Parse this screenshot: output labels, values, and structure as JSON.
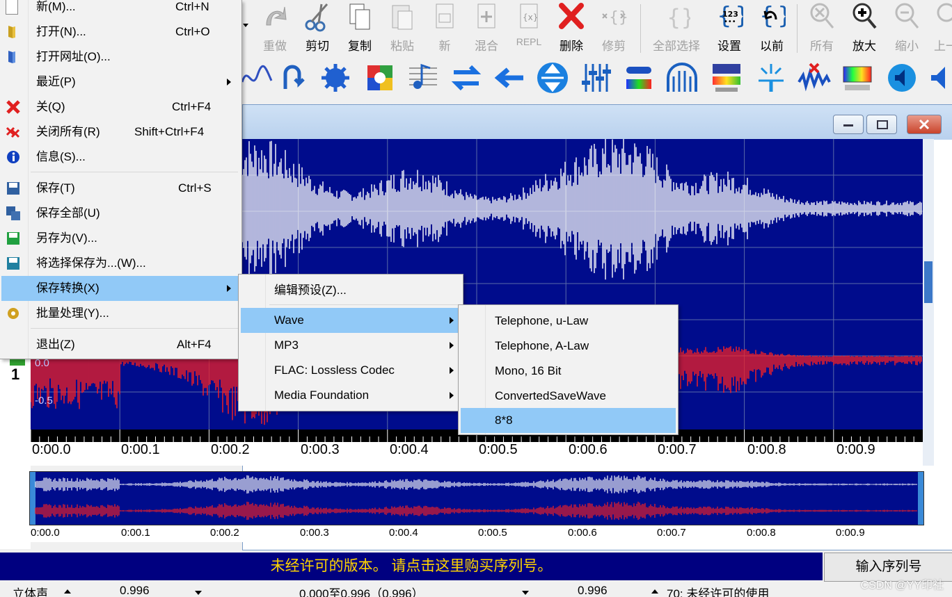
{
  "toolbar": {
    "buttons": [
      {
        "label": "重做",
        "icon": "redo-icon",
        "enabled": false
      },
      {
        "label": "剪切",
        "icon": "cut-icon",
        "enabled": true
      },
      {
        "label": "复制",
        "icon": "copy-icon",
        "enabled": true
      },
      {
        "label": "粘贴",
        "icon": "paste-icon",
        "enabled": false
      },
      {
        "label": "新",
        "icon": "new-icon",
        "enabled": false
      },
      {
        "label": "混合",
        "icon": "mix-icon",
        "enabled": false
      },
      {
        "label": "REPL",
        "icon": "replace-icon",
        "enabled": false
      },
      {
        "label": "删除",
        "icon": "delete-icon",
        "enabled": true
      },
      {
        "label": "修剪",
        "icon": "trim-icon",
        "enabled": false
      },
      {
        "label": "全部选择",
        "icon": "select-all-icon",
        "enabled": false
      },
      {
        "label": "设置",
        "icon": "settings-icon",
        "enabled": true
      },
      {
        "label": "以前",
        "icon": "previous-icon",
        "enabled": true
      },
      {
        "label": "所有",
        "icon": "zoom-all-icon",
        "enabled": false
      },
      {
        "label": "放大",
        "icon": "zoom-in-icon",
        "enabled": true
      },
      {
        "label": "缩小",
        "icon": "zoom-out-icon",
        "enabled": false
      },
      {
        "label": "上一",
        "icon": "zoom-prev-icon",
        "enabled": false
      }
    ],
    "settings_digits": "123"
  },
  "file_menu": {
    "items": [
      {
        "label": "新(M)...",
        "shortcut": "Ctrl+N",
        "icon": "new-file-icon"
      },
      {
        "label": "打开(N)...",
        "shortcut": "Ctrl+O",
        "icon": "open-icon"
      },
      {
        "label": "打开网址(O)...",
        "shortcut": "",
        "icon": "open-url-icon"
      },
      {
        "label": "最近(P)",
        "shortcut": "",
        "icon": "",
        "submenu": true
      },
      {
        "label": "关(Q)",
        "shortcut": "Ctrl+F4",
        "icon": "close-icon"
      },
      {
        "label": "关闭所有(R)",
        "shortcut": "Shift+Ctrl+F4",
        "icon": "close-all-icon"
      },
      {
        "label": "信息(S)...",
        "shortcut": "",
        "icon": "info-icon"
      },
      {
        "label": "保存(T)",
        "shortcut": "Ctrl+S",
        "icon": "save-icon"
      },
      {
        "label": "保存全部(U)",
        "shortcut": "",
        "icon": "save-all-icon"
      },
      {
        "label": "另存为(V)...",
        "shortcut": "",
        "icon": "save-as-icon"
      },
      {
        "label": "将选择保存为...(W)...",
        "shortcut": "",
        "icon": "save-selection-icon"
      },
      {
        "label": "保存转换(X)",
        "shortcut": "",
        "icon": "",
        "submenu": true,
        "highlighted": true
      },
      {
        "label": "批量处理(Y)...",
        "shortcut": "",
        "icon": "batch-icon"
      },
      {
        "label": "退出(Z)",
        "shortcut": "Alt+F4",
        "icon": ""
      }
    ]
  },
  "convert_menu": {
    "items": [
      {
        "label": "编辑预设(Z)...",
        "submenu": false
      },
      {
        "label": "Wave",
        "submenu": true,
        "highlighted": true
      },
      {
        "label": "MP3",
        "submenu": true
      },
      {
        "label": "FLAC: Lossless Codec",
        "submenu": true
      },
      {
        "label": "Media Foundation",
        "submenu": true
      }
    ]
  },
  "wave_menu": {
    "items": [
      {
        "label": "Telephone, u-Law"
      },
      {
        "label": "Telephone, A-Law"
      },
      {
        "label": "Mono, 16 Bit"
      },
      {
        "label": "ConvertedSaveWave"
      },
      {
        "label": "8*8",
        "highlighted": true
      }
    ]
  },
  "waveform": {
    "amplitude_labels": [
      "0.0",
      "-0.5"
    ],
    "channel_number": "1",
    "timeline": [
      "0:00.0",
      "0:00.1",
      "0:00.2",
      "0:00.3",
      "0:00.4",
      "0:00.5",
      "0:00.6",
      "0:00.7",
      "0:00.8",
      "0:00.9"
    ],
    "colors": {
      "background": "#000c8c",
      "channel1": "#ffffff",
      "channel2": "#ff2020",
      "grid": "#5a6aa8"
    }
  },
  "banner": {
    "text": "未经许可的版本。 请点击这里购买序列号。",
    "button": "输入序列号"
  },
  "statusbar": {
    "channels": "立体声",
    "length": "0.996",
    "selection": "0.000至0.996（0.996）",
    "position": "0.996",
    "license": "70: 未经许可的使用"
  },
  "watermark": "CSDN @YY印社"
}
